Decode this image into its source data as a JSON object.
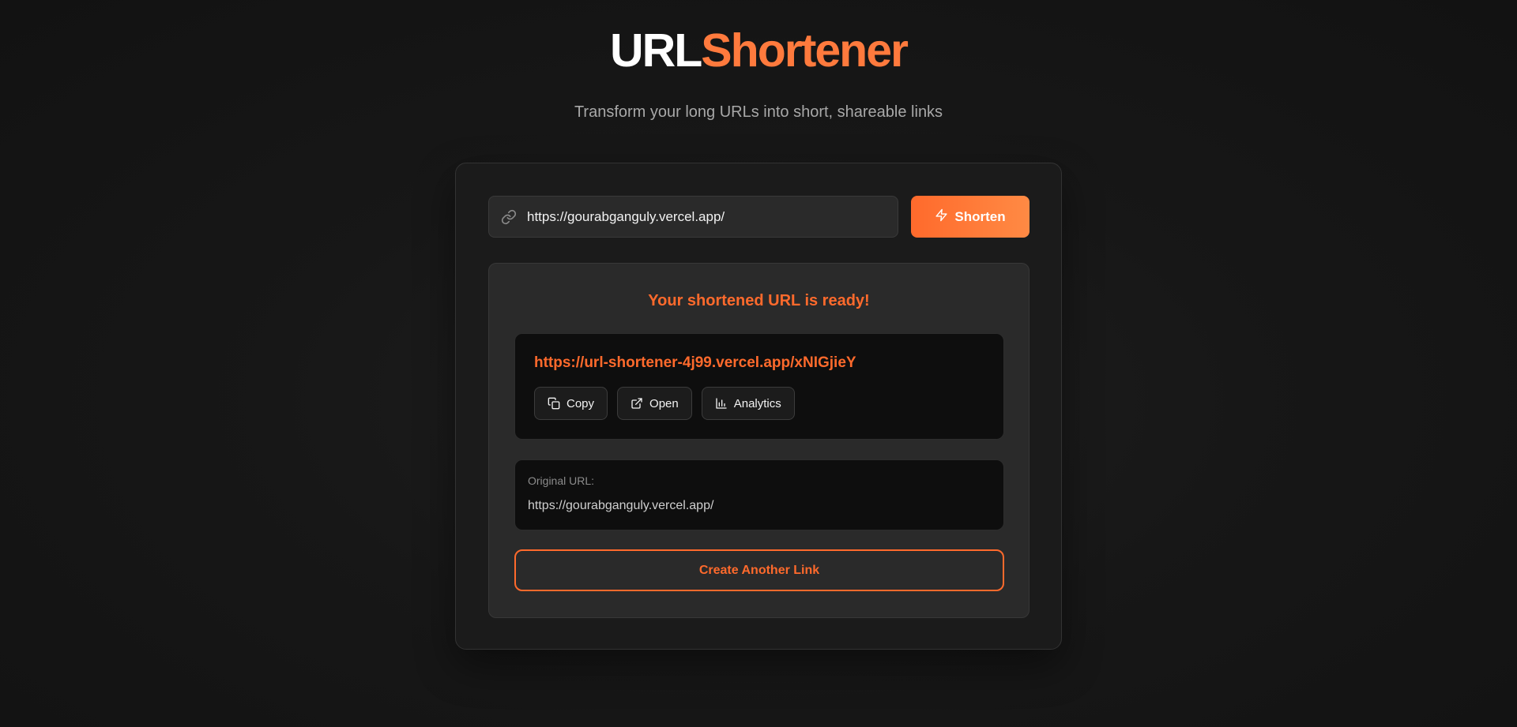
{
  "header": {
    "title_part1": "URL",
    "title_part2": "Shortener",
    "subtitle": "Transform your long URLs into short, shareable links"
  },
  "form": {
    "url_value": "https://gourabganguly.vercel.app/",
    "link_icon": "link-icon",
    "shorten_icon": "lightning-icon",
    "shorten_label": "Shorten"
  },
  "result": {
    "heading": "Your shortened URL is ready!",
    "short_url": "https://url-shortener-4j99.vercel.app/xNIGjieY",
    "actions": [
      {
        "label": "Copy",
        "icon": "copy-icon"
      },
      {
        "label": "Open",
        "icon": "external-link-icon"
      },
      {
        "label": "Analytics",
        "icon": "bar-chart-icon"
      }
    ],
    "original_label": "Original URL:",
    "original_url": "https://gourabganguly.vercel.app/",
    "create_another_label": "Create Another Link"
  },
  "colors": {
    "accent": "#ff6a2c",
    "background": "#141414",
    "card": "#1b1b1b",
    "panel": "#2a2a2a",
    "inner_box": "#0e0e0e"
  }
}
